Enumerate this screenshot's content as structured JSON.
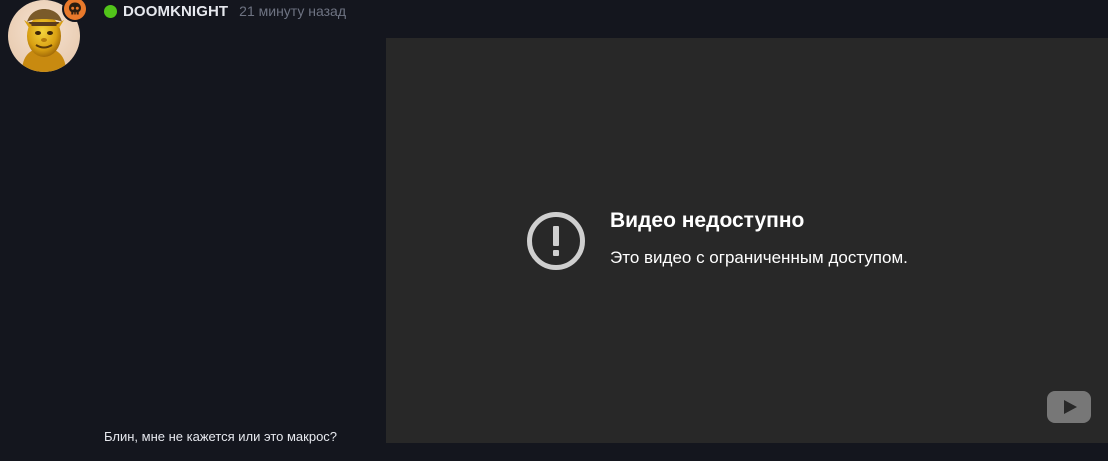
{
  "post": {
    "username": "DOOMKNIGHT",
    "time_ago": "21 минуту назад",
    "online_status": "online",
    "comment_text": "Блин, мне не кажется или это макрос?"
  },
  "video": {
    "title": "Видео недоступно",
    "message": "Это видео с ограниченным доступом.",
    "icon": "alert-circle-icon",
    "logo": "youtube-logo-icon"
  },
  "colors": {
    "background": "#14161e",
    "online": "#52c41a",
    "badge": "#e8792b",
    "video_background": "#282828"
  }
}
